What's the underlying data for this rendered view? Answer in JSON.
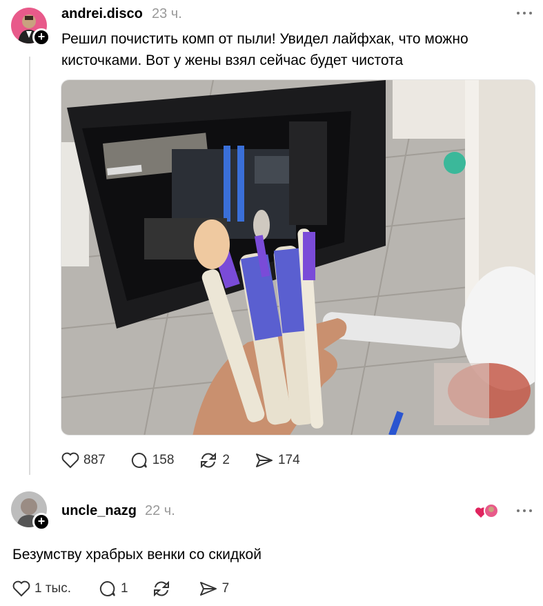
{
  "post": {
    "author": "andrei.disco",
    "time": "23 ч.",
    "text": "Решил почистить комп от пыли! Увидел лайфхак, что можно кисточками. Вот у жены взял сейчас будет чистота",
    "stats": {
      "likes": "887",
      "comments": "158",
      "reposts": "2",
      "shares": "174"
    }
  },
  "reply": {
    "author": "uncle_nazg",
    "time": "22 ч.",
    "text": "Безумству храбрых венки со скидкой",
    "stats": {
      "likes": "1 тыс.",
      "comments": "1",
      "reposts": "",
      "shares": "7"
    }
  },
  "colors": {
    "accent": "#e0245e",
    "muted": "#999999",
    "brush_purple": "#6a3fd0"
  }
}
